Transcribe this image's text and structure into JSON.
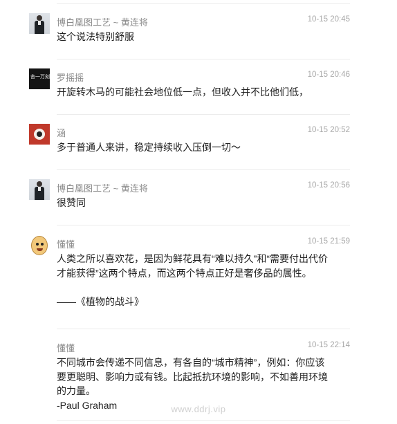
{
  "comments": [
    {
      "author": "博白凰图工艺 ~ 黄连将",
      "time": "10-15 20:45",
      "content": "这个说法特别舒服",
      "avatar_icon": "suit-portrait-avatar"
    },
    {
      "author": "罗摇摇",
      "time": "10-15 20:46",
      "content": "开旋转木马的可能社会地位低一点，但收入并不比他们低，",
      "avatar_icon": "text-logo-avatar",
      "avatar_text": "舍一万刻"
    },
    {
      "author": "涵",
      "time": "10-15 20:52",
      "content": "多于普通人来讲，稳定持续收入压倒一切～",
      "avatar_icon": "red-emblem-avatar"
    },
    {
      "author": "博白凰图工艺 ~ 黄连将",
      "time": "10-15 20:56",
      "content": "很赞同",
      "avatar_icon": "suit-portrait-avatar"
    },
    {
      "author": "懂懂",
      "time": "10-15 21:59",
      "content": "人类之所以喜欢花，是因为鲜花具有“难以持久”和“需要付出代价才能获得”这两个特点，而这两个特点正好是奢侈品的属性。\n\n——《植物的战斗》",
      "avatar_icon": "cartoon-face-avatar"
    },
    {
      "author": "懂懂",
      "time": "10-15 22:14",
      "content": "不同城市会传递不同信息，有各自的“城市精神”，例如：你应该要更聪明、影响力或有钱。比起抵抗环境的影响，不如善用环境的力量。\n-Paul Graham",
      "avatar_icon": "none"
    }
  ],
  "watermark": "www.ddrj.vip"
}
